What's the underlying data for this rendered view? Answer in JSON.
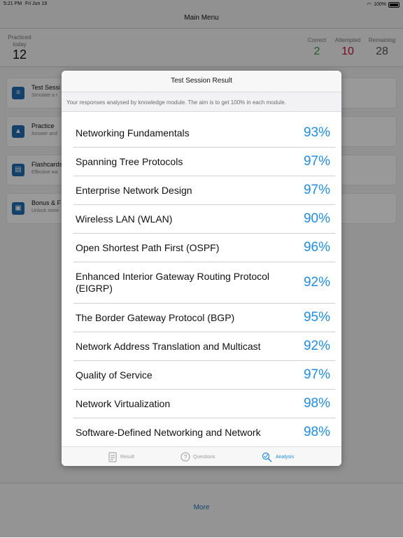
{
  "status_bar": {
    "time": "5:21 PM",
    "date": "Fri Jun 19",
    "battery": "100%"
  },
  "nav": {
    "title": "Main Menu"
  },
  "stats": {
    "practiced_label": "Practiced today",
    "practiced_value": "12",
    "correct_label": "Correct",
    "correct_value": "2",
    "attempted_label": "Attempted",
    "attempted_value": "10",
    "remaining_label": "Remaining",
    "remaining_value": "28",
    "colors": {
      "correct": "#3a9a3a",
      "attempted": "#c0143c",
      "remaining": "#555555"
    }
  },
  "menu": {
    "items": [
      {
        "title": "Test Sessi",
        "subtitle": "Simulate a r",
        "icon": "test-icon"
      },
      {
        "title": "Practice",
        "subtitle": "Answer and",
        "icon": "graduation-cap-icon"
      },
      {
        "title": "Flashcards",
        "subtitle": "Effective wa",
        "icon": "flashcards-icon"
      },
      {
        "title": "Bonus & F",
        "subtitle": "Unlock more",
        "icon": "bonus-icon"
      }
    ]
  },
  "bottom": {
    "more_label": "More"
  },
  "modal": {
    "title": "Test Session Result",
    "info": "Your responses analysed by knowledge module. The aim is to get 100% in each module.",
    "rows": [
      {
        "label": "Networking Fundamentals",
        "value": "93%"
      },
      {
        "label": "Spanning Tree Protocols",
        "value": "97%"
      },
      {
        "label": "Enterprise Network Design",
        "value": "97%"
      },
      {
        "label": "Wireless LAN (WLAN)",
        "value": "90%"
      },
      {
        "label": "Open Shortest Path First (OSPF)",
        "value": "96%"
      },
      {
        "label": "Enhanced Interior Gateway Routing Protocol (EIGRP)",
        "value": "92%"
      },
      {
        "label": "The Border Gateway Protocol (BGP)",
        "value": "95%"
      },
      {
        "label": "Network Address Translation and Multicast",
        "value": "92%"
      },
      {
        "label": "Quality of Service",
        "value": "97%"
      },
      {
        "label": "Network Virtualization",
        "value": "98%"
      },
      {
        "label": "Software-Defined Networking and Network",
        "value": "98%"
      }
    ],
    "tabs": [
      {
        "label": "Result",
        "icon": "result-icon"
      },
      {
        "label": "Questions",
        "icon": "question-icon"
      },
      {
        "label": "Analysis",
        "icon": "analysis-icon",
        "active": true
      }
    ],
    "accent": "#1d8cf0"
  }
}
